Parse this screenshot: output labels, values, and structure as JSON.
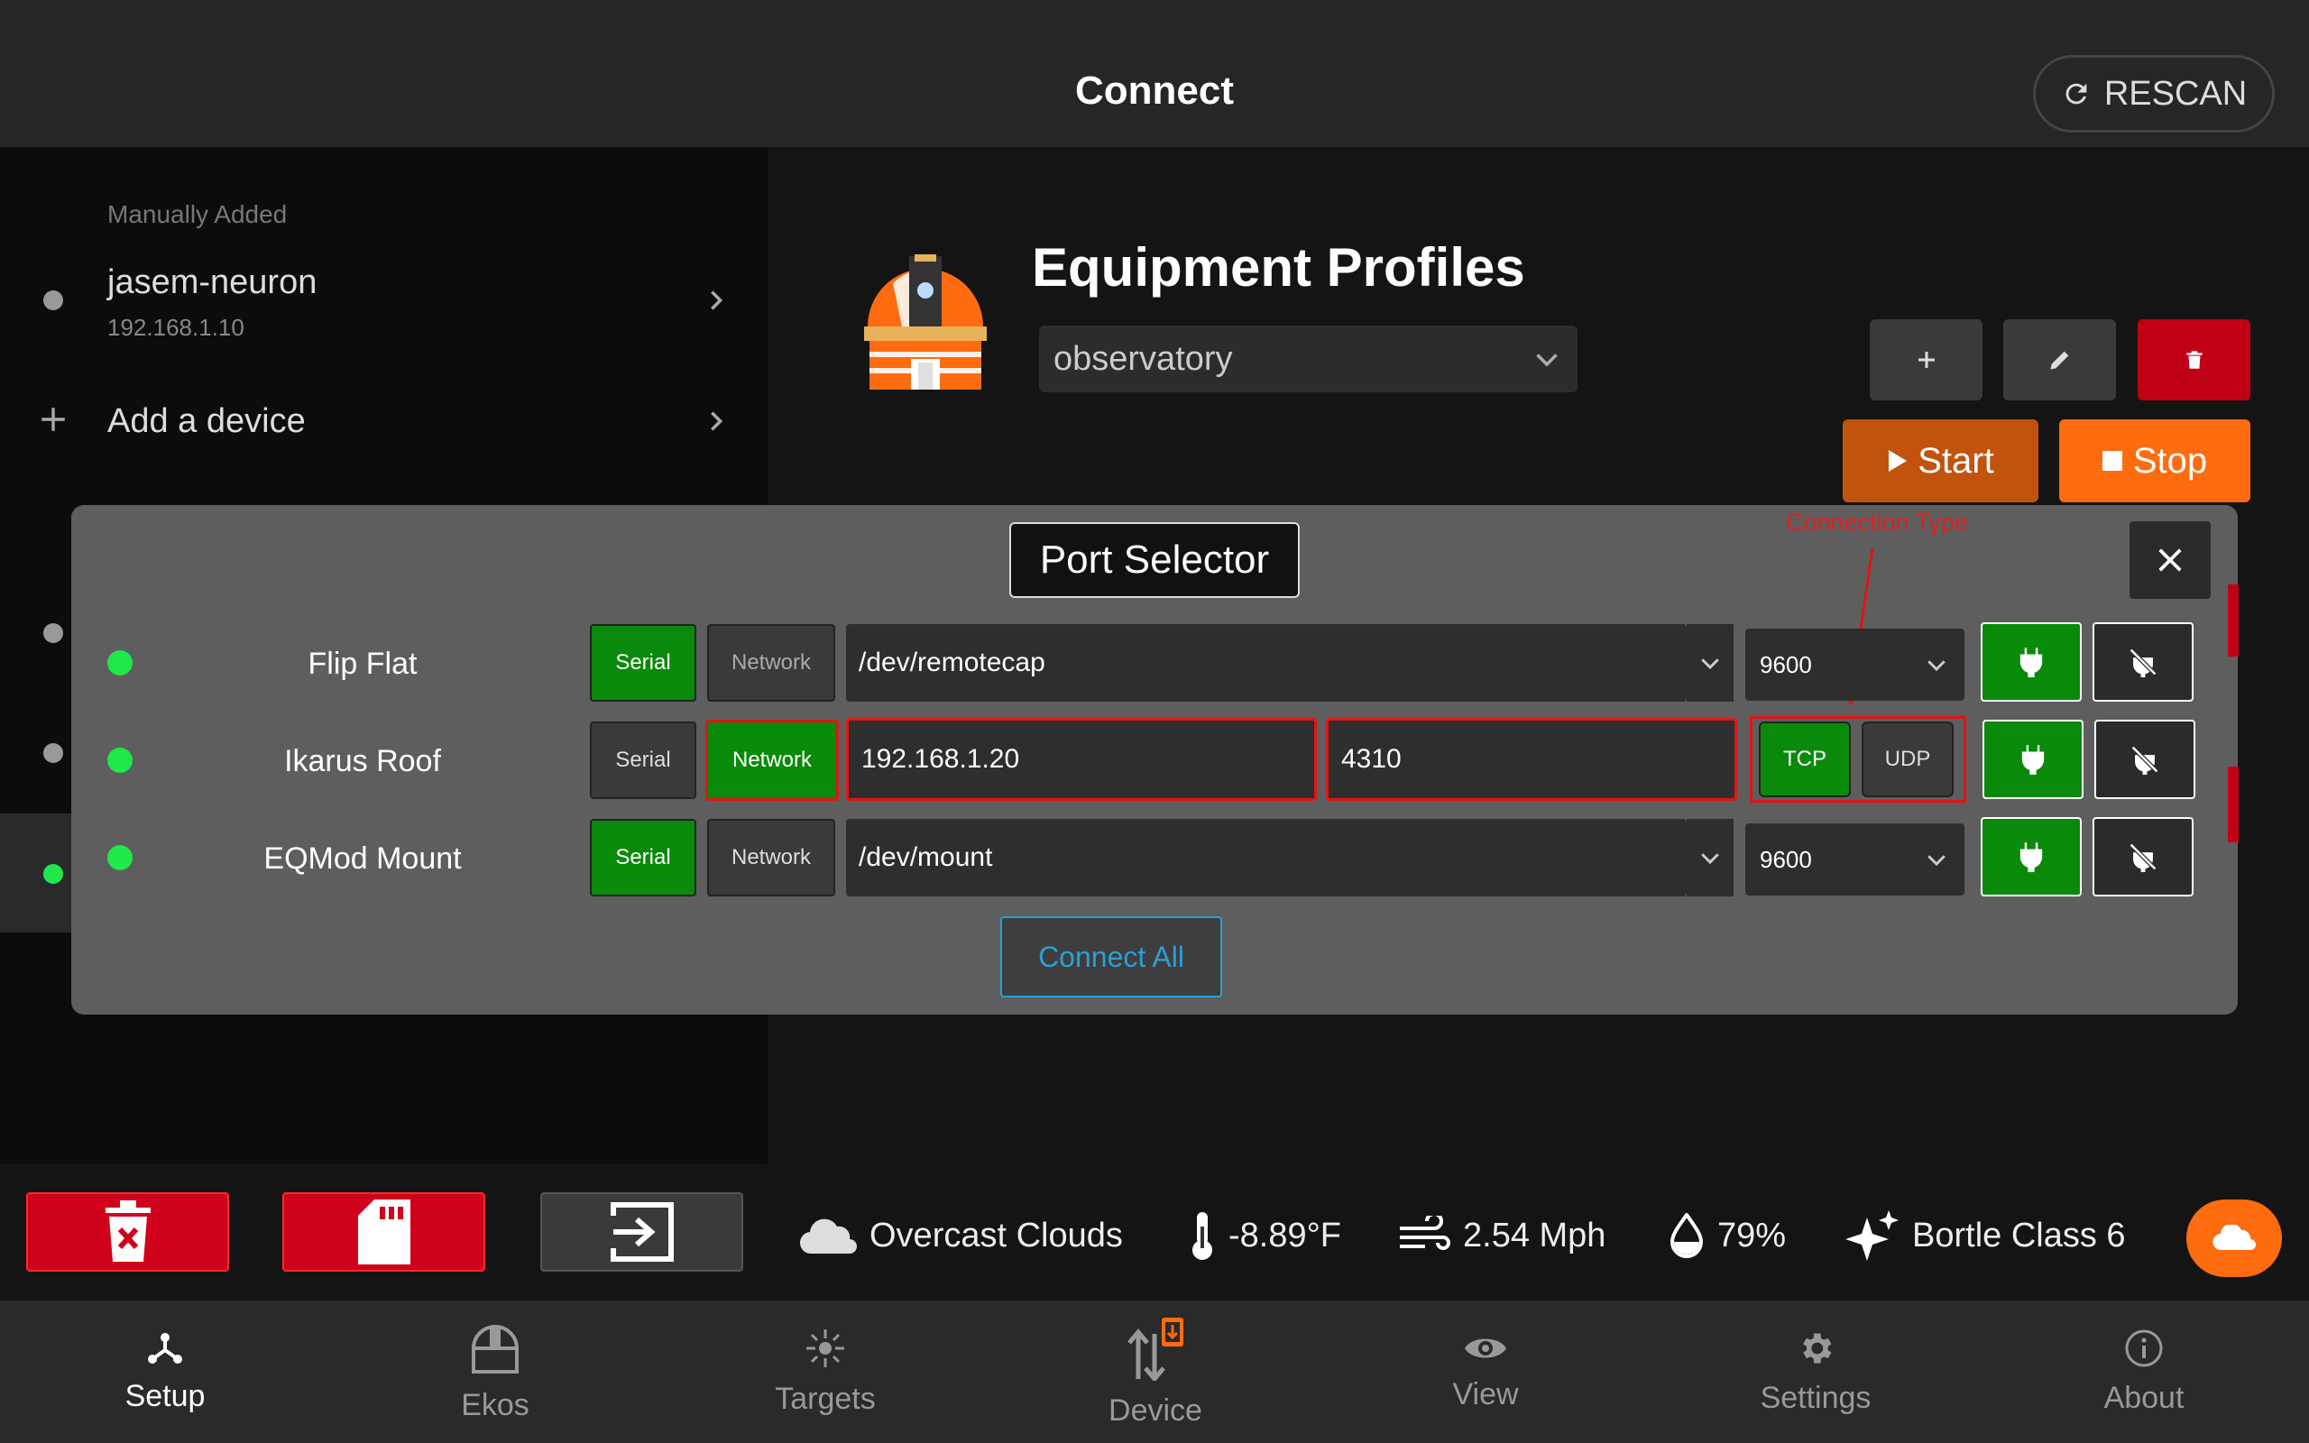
{
  "header": {
    "title": "Connect",
    "rescan_label": "RESCAN"
  },
  "sidebar": {
    "section_label": "Manually Added",
    "devices": [
      {
        "name": "jasem-neuron",
        "ip": "192.168.1.10"
      }
    ],
    "add_device_label": "Add a device"
  },
  "profiles": {
    "title": "Equipment Profiles",
    "selected": "observatory",
    "start_label": "Start",
    "stop_label": "Stop"
  },
  "port_selector": {
    "title": "Port Selector",
    "annotation": "Connection Type",
    "rows": [
      {
        "name": "Flip Flat",
        "serial_label": "Serial",
        "network_label": "Network",
        "mode": "serial",
        "port": "/dev/remotecap",
        "baud": "9600"
      },
      {
        "name": "Ikarus Roof",
        "serial_label": "Serial",
        "network_label": "Network",
        "mode": "network",
        "host": "192.168.1.20",
        "port_number": "4310",
        "tcp_label": "TCP",
        "udp_label": "UDP",
        "protocol": "TCP"
      },
      {
        "name": "EQMod Mount",
        "serial_label": "Serial",
        "network_label": "Network",
        "mode": "serial",
        "port": "/dev/mount",
        "baud": "9600"
      }
    ],
    "connect_all_label": "Connect All"
  },
  "status": {
    "weather": "Overcast Clouds",
    "temperature": "-8.89°F",
    "wind": "2.54 Mph",
    "humidity": "79%",
    "bortle": "Bortle Class 6"
  },
  "nav": {
    "items": [
      {
        "label": "Setup",
        "icon": "setup-icon",
        "active": true
      },
      {
        "label": "Ekos",
        "icon": "dome-icon"
      },
      {
        "label": "Targets",
        "icon": "targets-icon"
      },
      {
        "label": "Device",
        "icon": "device-icon"
      },
      {
        "label": "View",
        "icon": "eye-icon"
      },
      {
        "label": "Settings",
        "icon": "gear-icon"
      },
      {
        "label": "About",
        "icon": "info-icon"
      }
    ]
  },
  "colors": {
    "accent": "#ff6b0f",
    "success": "#0a8a0a",
    "danger": "#d0021b",
    "link": "#2a9fd6"
  }
}
